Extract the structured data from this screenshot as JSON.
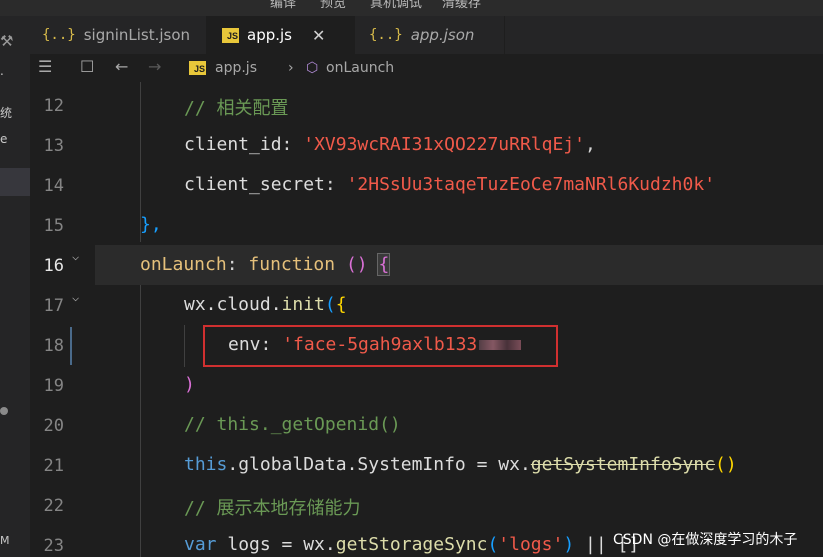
{
  "menubar": {
    "items": [
      "编译",
      "预览",
      "真机调试",
      "清缓存"
    ]
  },
  "activity": {
    "text1": "统",
    "text2": "e",
    "text3": "M"
  },
  "tabs": [
    {
      "label": "signinList.json",
      "icon": "json-braces-icon",
      "active": false,
      "italic": false
    },
    {
      "label": "app.js",
      "icon": "js-file-icon",
      "active": true,
      "italic": false,
      "close": "✕"
    },
    {
      "label": "app.json",
      "icon": "json-braces-icon",
      "active": false,
      "italic": true
    }
  ],
  "breadcrumb": {
    "file": "app.js",
    "symbol": "onLaunch",
    "sep": "›"
  },
  "editor": {
    "line_numbers": [
      "12",
      "13",
      "14",
      "15",
      "16",
      "17",
      "18",
      "19",
      "20",
      "21",
      "22",
      "23"
    ],
    "current_line": "16",
    "lines": {
      "l12_comment": "// 相关配置",
      "l13_key": "client_id",
      "l13_val": "'XV93wcRAI31xQO227uRRlqEj'",
      "l14_key": "client_secret",
      "l14_val": "'2HSsUu3taqeTuzEoCe7maNRl6Kudzh0k'",
      "l15": "},",
      "l16_name": "onLaunch",
      "l16_kw": "function",
      "l17_obj": "wx.cloud.",
      "l17_fn": "init",
      "l18_key": "env",
      "l18_val": "'face-5gah9axlb133",
      "l19": ")",
      "l20_comment": "// this._getOpenid()",
      "l21_this": "this",
      "l21_rest": ".globalData.SystemInfo = wx.",
      "l21_fn": "getSystemInfoSync",
      "l22_comment": "// 展示本地存储能力",
      "l23_var": "var",
      "l23_mid": " logs = wx.",
      "l23_fn": "getStorageSync",
      "l23_arg": "'logs'",
      "l23_tail": " || []"
    }
  },
  "watermark": "CSDN @在做深度学习的木子",
  "colors": {
    "string": "#f05a4a",
    "keyword": "#569cd6",
    "function": "#dcdcaa",
    "comment": "#6a9955",
    "highlight_box": "#d03030"
  }
}
